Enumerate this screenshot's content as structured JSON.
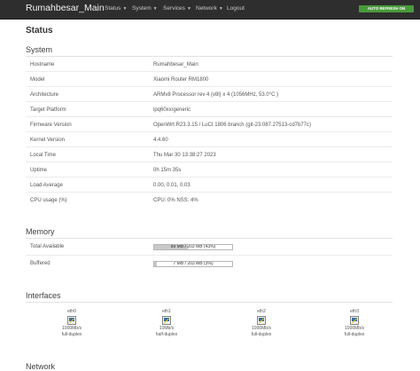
{
  "navbar": {
    "brand": "Rumahbesar_Main",
    "menu": [
      {
        "label": "Status",
        "dropdown": true
      },
      {
        "label": "System",
        "dropdown": true
      },
      {
        "label": "Services",
        "dropdown": true
      },
      {
        "label": "Network",
        "dropdown": true
      },
      {
        "label": "Logout",
        "dropdown": false
      }
    ],
    "auto_refresh_label": "AUTO REFRESH ON",
    "auto_refresh_color": "#4a9a3c"
  },
  "page": {
    "title": "Status"
  },
  "system": {
    "heading": "System",
    "rows": [
      {
        "label": "Hostname",
        "value": "Rumahbesar_Main"
      },
      {
        "label": "Model",
        "value": "Xiaomi Router RM1800"
      },
      {
        "label": "Architecture",
        "value": "ARMv8 Processor rev 4 (v8l) x 4 (1056MHz, 53.0°C )"
      },
      {
        "label": "Target Platform",
        "value": "ipq60xx/generic"
      },
      {
        "label": "Firmware Version",
        "value": "OpenWrt R23.3.15 / LuCI 1806 branch (git-23.087.27513-cd7b77c)"
      },
      {
        "label": "Kernel Version",
        "value": "4.4.60"
      },
      {
        "label": "Local Time",
        "value": "Thu Mar 30 13:38:27 2023"
      },
      {
        "label": "Uptime",
        "value": "0h 15m 35s"
      },
      {
        "label": "Load Average",
        "value": "0.00, 0.01, 0.03"
      },
      {
        "label": "CPU usage (%)",
        "value": "CPU: 0% NSS: 4%"
      }
    ]
  },
  "memory": {
    "heading": "Memory",
    "rows": [
      {
        "label": "Total Available",
        "text": "89 MB / 203 MB (43%)",
        "fraction": 0.43
      },
      {
        "label": "Buffered",
        "text": "7 MB / 203 MB (3%)",
        "fraction": 0.03
      }
    ]
  },
  "interfaces": {
    "heading": "Interfaces",
    "items": [
      {
        "name": "eth0",
        "speed": "1000Mb/s",
        "duplex": "full-duplex"
      },
      {
        "name": "eth1",
        "speed": "10Mb/s",
        "duplex": "half-duplex"
      },
      {
        "name": "eth2",
        "speed": "1000Mb/s",
        "duplex": "full-duplex"
      },
      {
        "name": "eth3",
        "speed": "1000Mb/s",
        "duplex": "full-duplex"
      }
    ]
  },
  "network": {
    "heading": "Network"
  }
}
